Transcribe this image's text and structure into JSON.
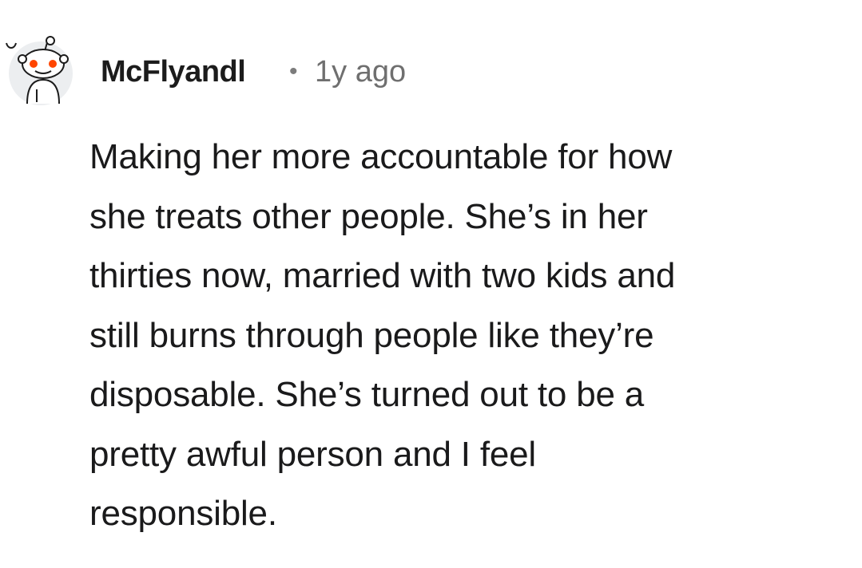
{
  "comment": {
    "author": "McFlyandl",
    "separator": "•",
    "timestamp": "1y ago",
    "lines": [
      "Making her more accountable for how",
      "she treats other people. She’s in her",
      "thirties now, married with two kids and",
      "still burns through people like they’re",
      "disposable. She’s turned out to be a",
      "pretty awful person and I feel",
      "responsible."
    ]
  },
  "icons": {
    "avatar": "reddit-snoo-avatar-icon"
  },
  "colors": {
    "author": "#1c1c1c",
    "meta": "#6f6f6f",
    "body": "#1a1a1b",
    "snoo_accent": "#ff4500"
  }
}
